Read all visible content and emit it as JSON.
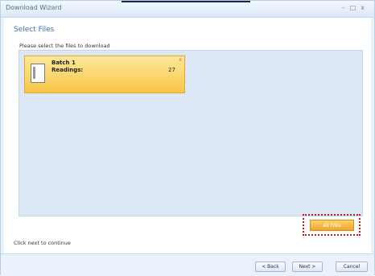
{
  "window": {
    "title": "Download Wizard",
    "controls": [
      "–",
      "□",
      "x"
    ]
  },
  "page": {
    "heading": "Select Files",
    "instruction": "Please select the files to download",
    "status": "Click next to continue"
  },
  "files": [
    {
      "name": "Batch 1",
      "readings_label": "Readings:",
      "readings_count": "27",
      "icon": "document-icon"
    }
  ],
  "all_files_button": "All Files",
  "footer": {
    "back": "< Back",
    "next": "Next >",
    "cancel": "Cancel"
  },
  "colors": {
    "accent": "#3a6fb5",
    "tile": "#f8c649",
    "highlight": "#c21c1c"
  }
}
